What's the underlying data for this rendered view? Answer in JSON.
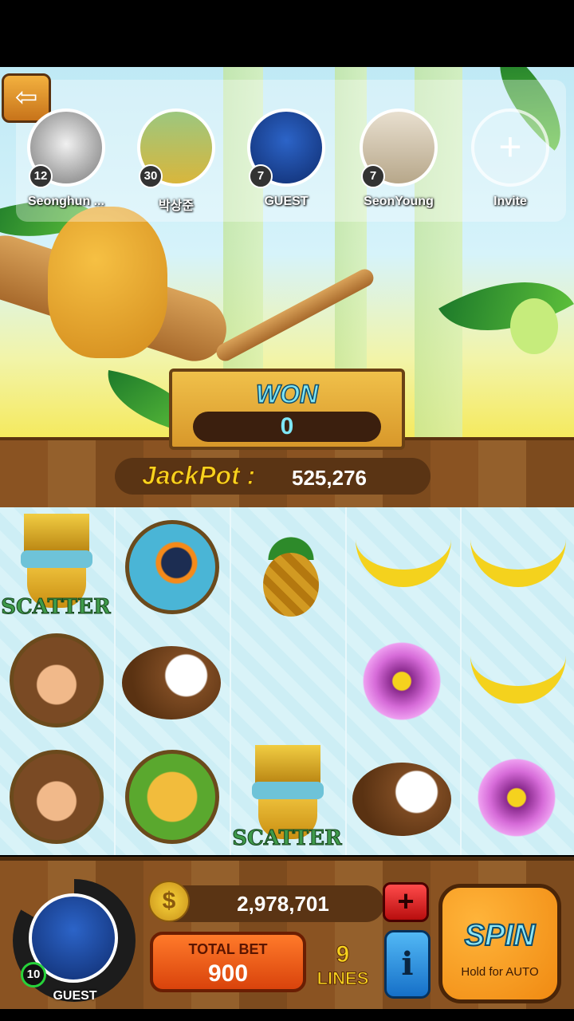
{
  "friends": [
    {
      "name": "Seonghun ...",
      "level": "12"
    },
    {
      "name": "박상준",
      "level": "30"
    },
    {
      "name": "GUEST",
      "level": "7"
    },
    {
      "name": "SeonYoung",
      "level": "7"
    },
    {
      "name": "Invite",
      "level": ""
    }
  ],
  "won": {
    "label": "WON",
    "value": "0"
  },
  "jackpot": {
    "label": "JackPot :",
    "value": "525,276"
  },
  "reels": [
    [
      "scatter-mask",
      "monkey",
      "monkey"
    ],
    [
      "toucan",
      "coconut",
      "jaguar"
    ],
    [
      "pineapple",
      "empty",
      "scatter-mask"
    ],
    [
      "banana",
      "orchid",
      "coconut"
    ],
    [
      "banana",
      "banana",
      "orchid"
    ]
  ],
  "scatter_text": "SCATTER",
  "player": {
    "name": "GUEST",
    "level": "10"
  },
  "coins": {
    "value": "2,978,701",
    "symbol": "$"
  },
  "bet": {
    "label": "TOTAL BET",
    "value": "900"
  },
  "lines": {
    "count": "9",
    "label": "LINES"
  },
  "buttons": {
    "add": "+",
    "info": "i",
    "spin": "SPIN",
    "spin_hint": "Hold for AUTO",
    "exit": "⇦"
  },
  "colors": {
    "wood": "#8a5322",
    "spin_orange": "#f08a12",
    "gold_text": "#f7d21e",
    "won_cyan": "#7fe4f2"
  }
}
